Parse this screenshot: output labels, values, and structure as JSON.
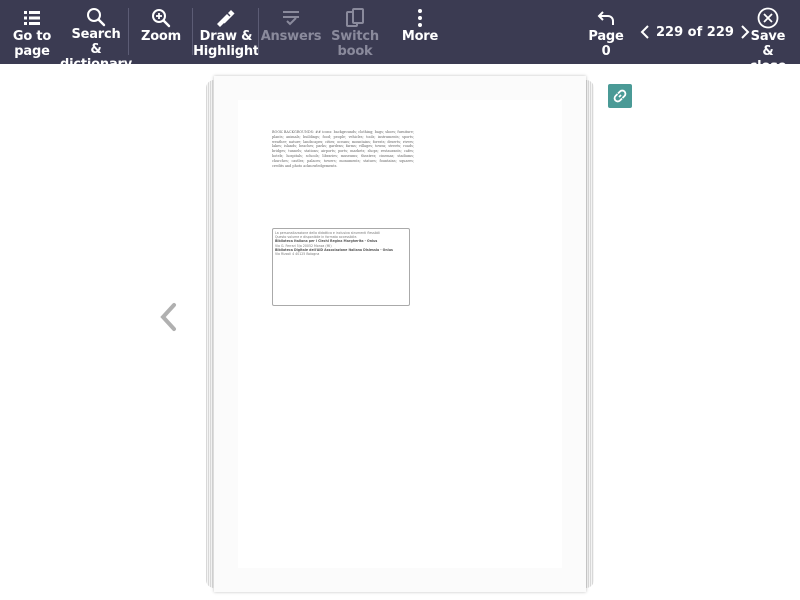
{
  "toolbar": {
    "goto_label_1": "Go to",
    "goto_label_2": "page",
    "search_label_1": "Search &",
    "search_label_2": "dictionary",
    "zoom_label": "Zoom",
    "draw_label_1": "Draw &",
    "draw_label_2": "Highlight",
    "answers_label": "Answers",
    "switch_label_1": "Switch",
    "switch_label_2": "book",
    "more_label": "More",
    "page0_label": "Page 0",
    "page_indicator": "229 of 229",
    "save_label_1": "Save &",
    "save_label_2": "close"
  },
  "icons": {
    "goto": "list-icon",
    "search": "magnifier-icon",
    "zoom": "zoom-in-icon",
    "draw": "pen-icon",
    "answers": "checklist-icon",
    "switch": "switch-book-icon",
    "more": "more-vertical-icon",
    "page0": "undo-arrow-icon",
    "prev_page": "chevron-left-icon",
    "next_page": "chevron-right-icon",
    "save": "close-circle-icon",
    "link": "link-icon",
    "reader_prev": "chevron-left-icon"
  },
  "colors": {
    "toolbar_bg": "#3b3b52",
    "disabled": "#8a8a9c",
    "link_button": "#4a9a96"
  },
  "page": {
    "body_text": "BOOK BACKGROUNDS: ## icons: backgrounds; clothing; bags; shoes; furniture; plants; animals; buildings; food; people; vehicles; tools; instruments; sports; weather; nature; landscapes; cities; oceans; mountains; forests; deserts; rivers; lakes; islands; beaches; parks; gardens; farms; villages; towns; streets; roads; bridges; tunnels; stations; airports; ports; markets; shops; restaurants; cafes; hotels; hospitals; schools; libraries; museums; theatres; cinemas; stadiums; churches; castles; palaces; towers; monuments; statues; fountains; squares; credits and photo acknowledgements.",
    "box_line1": "La personalizzazione della didattica e inclusiva strumenti flessibili",
    "box_line2": "Questo volume e disponibile in formato accessibile.",
    "box_title1": "Biblioteca Italiana per i Ciechi Regina Margherita - Onlus",
    "box_line3": "Via G. Ferrari 5/a  20052 Monza (MI)",
    "box_title2": "Biblioteca Digitale dell'AID Associazione Italiana Dislessia - Onlus",
    "box_line4": "Via Rizzoli 4  40125 Bologna"
  }
}
